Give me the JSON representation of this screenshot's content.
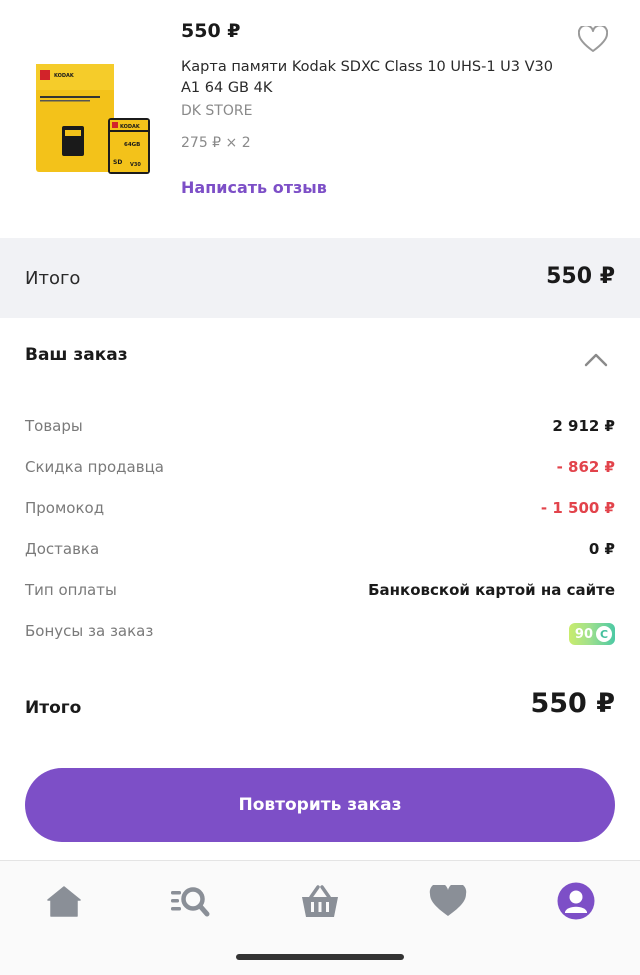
{
  "product": {
    "price": "550 ₽",
    "title": "Карта памяти Kodak SDXC Class 10 UHS-1 U3 V30 A1 64 GB 4K",
    "store": "DK STORE",
    "unit_price": "275 ₽ × 2",
    "review_link": "Написать отзыв",
    "image_brand": "KODAK",
    "image_capacity": "64GB"
  },
  "summary": {
    "total_label": "Итого",
    "total_value": "550 ₽"
  },
  "order": {
    "heading": "Ваш заказ",
    "rows": [
      {
        "label": "Товары",
        "value": "2 912 ₽"
      },
      {
        "label": "Скидка продавца",
        "value": "- 862 ₽"
      },
      {
        "label": "Промокод",
        "value": "- 1 500 ₽"
      },
      {
        "label": "Доставка",
        "value": "0 ₽"
      },
      {
        "label": "Тип оплаты",
        "value": "Банковской картой на сайте"
      },
      {
        "label": "Бонусы за заказ",
        "value": "90"
      }
    ],
    "final_label": "Итого",
    "final_value": "550 ₽",
    "repeat_button": "Повторить заказ"
  },
  "colors": {
    "accent": "#7d4fc7",
    "discount": "#e2434b",
    "nav_icon": "#8a8f97"
  },
  "nav": {
    "items": [
      {
        "icon": "home-icon"
      },
      {
        "icon": "catalog-search-icon"
      },
      {
        "icon": "basket-icon"
      },
      {
        "icon": "heart-icon"
      },
      {
        "icon": "profile-icon",
        "active": true
      }
    ]
  }
}
